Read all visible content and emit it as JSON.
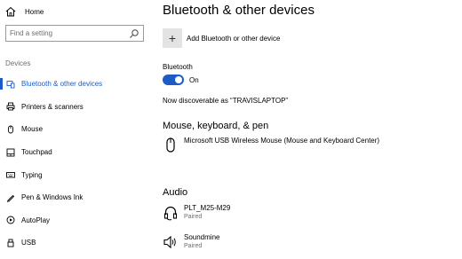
{
  "sidebar": {
    "home_label": "Home",
    "search_placeholder": "Find a setting",
    "section_label": "Devices",
    "items": [
      {
        "label": "Bluetooth & other devices",
        "icon": "bluetooth-icon"
      },
      {
        "label": "Printers & scanners",
        "icon": "printer-icon"
      },
      {
        "label": "Mouse",
        "icon": "mouse-icon"
      },
      {
        "label": "Touchpad",
        "icon": "touchpad-icon"
      },
      {
        "label": "Typing",
        "icon": "keyboard-icon"
      },
      {
        "label": "Pen & Windows Ink",
        "icon": "pen-icon"
      },
      {
        "label": "AutoPlay",
        "icon": "autoplay-icon"
      },
      {
        "label": "USB",
        "icon": "usb-icon"
      }
    ],
    "active_index": 0
  },
  "main": {
    "title": "Bluetooth & other devices",
    "add_label": "Add Bluetooth or other device",
    "bluetooth_label": "Bluetooth",
    "bluetooth_state": "On",
    "discoverable_text": "Now discoverable as “TRAVISLAPTOP”",
    "mouse_section": {
      "heading": "Mouse, keyboard, & pen",
      "devices": [
        {
          "name": "Microsoft USB Wireless Mouse (Mouse and Keyboard Center)",
          "status": "",
          "icon": "mouse-icon"
        }
      ]
    },
    "audio_section": {
      "heading": "Audio",
      "devices": [
        {
          "name": "PLT_M25-M29",
          "status": "Paired",
          "icon": "headset-icon"
        },
        {
          "name": "Soundmine",
          "status": "Paired",
          "icon": "speaker-icon"
        }
      ]
    }
  },
  "colors": {
    "accent": "#1e5bc6",
    "muted_text": "#6d6d6d",
    "add_button_bg": "#e3e3e3"
  }
}
